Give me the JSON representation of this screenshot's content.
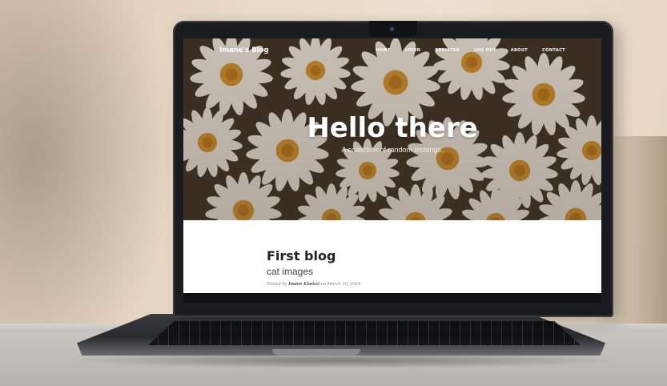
{
  "site": {
    "brand": "Imane's Blog",
    "nav": [
      "HOME",
      "LOGIN",
      "REGISTER",
      "LOG OUT",
      "ABOUT",
      "CONTACT"
    ]
  },
  "hero": {
    "title": "Hello there",
    "subtitle": "A collection of random musings."
  },
  "post": {
    "title": "First blog",
    "subtitle": "cat images",
    "meta_prefix": "Posted by",
    "author": "Imane Kimissi",
    "date_prefix": "on",
    "date": "March 10, 2024"
  },
  "colors": {
    "hero_overlay": "#5a4a35",
    "petal": "#f4efe6",
    "center": "#d9962a",
    "laptop_body": "#1b1c1f"
  }
}
